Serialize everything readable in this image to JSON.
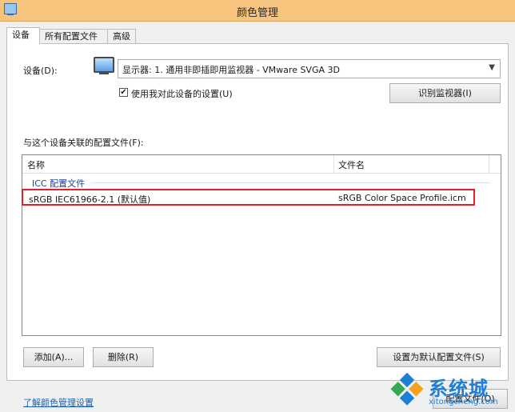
{
  "window": {
    "title": "颜色管理"
  },
  "tabs": [
    {
      "label": "设备",
      "active": true
    },
    {
      "label": "所有配置文件",
      "active": false
    },
    {
      "label": "高级",
      "active": false
    }
  ],
  "device": {
    "label": "设备(D):",
    "selected": "显示器: 1. 通用非即插即用监视器 - VMware SVGA 3D",
    "use_my_settings_label": "使用我对此设备的设置(U)",
    "use_my_settings_checked": true,
    "identify_button": "识别监视器(I)"
  },
  "profiles": {
    "section_label": "与这个设备关联的配置文件(F):",
    "columns": [
      "名称",
      "文件名"
    ],
    "group": "ICC 配置文件",
    "rows": [
      {
        "name": "sRGB IEC61966-2.1 (默认值)",
        "file": "sRGB Color Space Profile.icm"
      }
    ]
  },
  "buttons": {
    "add": "添加(A)...",
    "remove": "删除(R)",
    "set_default": "设置为默认配置文件(S)",
    "profiles": "配置文件(O)"
  },
  "footer": {
    "link": "了解颜色管理设置"
  },
  "watermark": {
    "brand": "系统城",
    "url": "xitongcheng.com"
  },
  "colors": {
    "titlebar": "#f6c47d",
    "highlight": "#e5202a",
    "link": "#1a5fb4",
    "watermark": "#1d7fd6"
  }
}
